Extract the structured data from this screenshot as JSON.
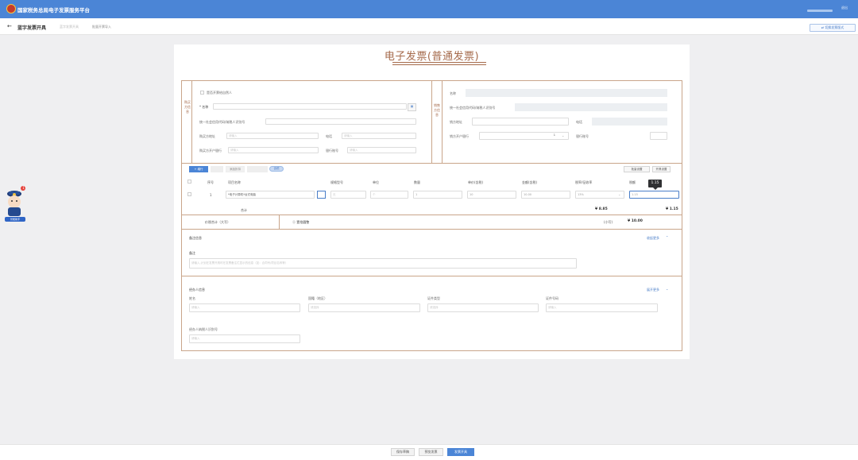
{
  "header": {
    "platform_title": "国家税务总局电子发票服务平台",
    "user_status": "退出"
  },
  "subheader": {
    "back_icon": "arrow-left-icon",
    "page_title": "蓝字发票开具",
    "breadcrumb": [
      "蓝字发票开具",
      "批量开票导入"
    ],
    "switch_button": "切换发票版式"
  },
  "invoice": {
    "title": "电子发票(普通发票)",
    "buyer_heading": "购买方信息",
    "seller_heading": "销售方信息",
    "buyer": {
      "natural_person_checkbox": "是否开票给自然人",
      "name_label": "* 名称",
      "name_search_icon": "building-search-icon",
      "tax_id_label": "统一社会信用代码/纳税人识别号",
      "address_label": "购买方地址",
      "address_placeholder": "请输入",
      "phone_label": "电话",
      "phone_placeholder": "请输入",
      "bank_label": "购买方开户银行",
      "bank_placeholder": "请输入",
      "account_label": "银行账号",
      "account_placeholder": "请输入"
    },
    "seller": {
      "name_label": "名称",
      "tax_id_label": "统一社会信用代码/纳税人识别号",
      "address_label": "销方地址",
      "phone_label": "电话",
      "bank_label": "销方开户银行",
      "account_label": "银行账号",
      "bank_select_value": "1"
    },
    "toolbar": {
      "add_button": "+ 增行",
      "delete_button": "删除行",
      "discount_button": "添加折扣",
      "tax_toggle": "含税",
      "right_button_1": "批量设置",
      "right_button_2": "开具设置"
    },
    "table": {
      "headers": [
        "序号",
        "项目名称",
        "规格型号",
        "单位",
        "数量",
        "单价(含税)",
        "金额(含税)",
        "税率/征收率",
        "税额"
      ],
      "rows": [
        {
          "index": "1",
          "item_name": "*电子计算机*台式电脑",
          "spec": "无",
          "unit": "个",
          "quantity": "1",
          "unit_price": "10",
          "amount": "10.00",
          "tax_rate": "13%",
          "tax": "1.15"
        }
      ],
      "subtotal_label": "合计",
      "subtotal_amount": "¥ 8.85",
      "subtotal_tax": "¥ 1.15",
      "total_label": "价税合计（大写）",
      "total_upper": "ⓧ 壹拾圆整",
      "total_lower_label": "(小写)",
      "total_lower": "¥ 10.00",
      "tooltip_value": "1.15"
    },
    "remarks": {
      "section_title": "备注信息",
      "toggle": "收起更多",
      "remark_label": "备注",
      "remark_placeholder": "请输入,计划在发票开具时在发票备注栏显示的信息（如：合同号/项目名称等）"
    },
    "handler": {
      "section_title": "经办人信息",
      "toggle": "展开更多",
      "name_label": "姓名",
      "name_placeholder": "请输入",
      "nationality_label": "国籍（地区）",
      "nationality_placeholder": "请选择",
      "id_type_label": "证件类型",
      "id_type_placeholder": "请选择",
      "id_number_label": "证件号码",
      "id_number_placeholder": "请输入",
      "taxpayer_id_label": "经办人纳税人识别号",
      "taxpayer_id_placeholder": "请输入"
    }
  },
  "footer": {
    "buttons": [
      "保存草稿",
      "预览发票",
      "发票开具"
    ],
    "primary_color": "#4b85d6"
  },
  "assistant": {
    "avatar_icon": "police-assistant-icon",
    "badge": "1",
    "label": "智能助手"
  },
  "colors": {
    "header_bg": "#4b85d6",
    "invoice_brown": "#a56a4b",
    "frame": "#c9a58a",
    "link": "#4a7ec8"
  }
}
